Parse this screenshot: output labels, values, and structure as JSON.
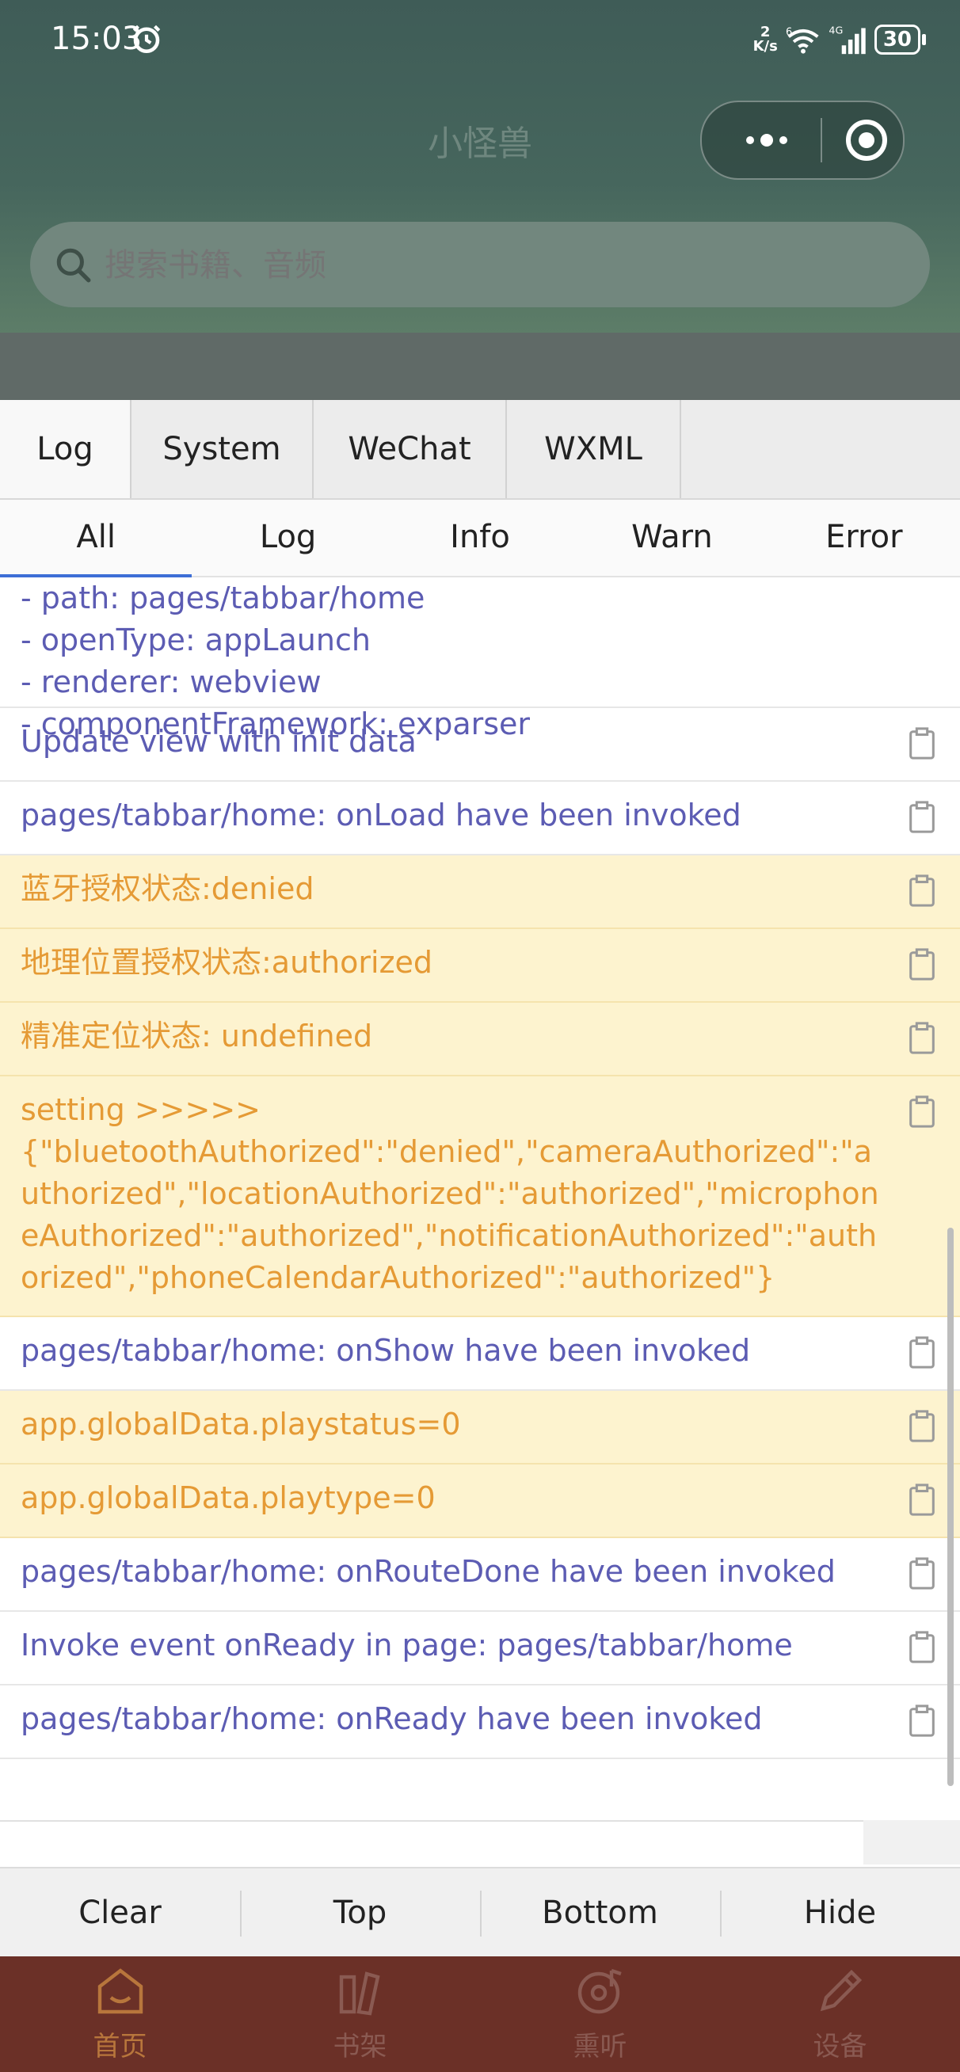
{
  "status_bar": {
    "time": "15:03",
    "net_speed_value": "2",
    "net_speed_unit": "K/s",
    "signal_label": "6",
    "network_label": "4G",
    "battery": "30"
  },
  "header": {
    "title": "小怪兽",
    "search_placeholder": "搜索书籍、音频"
  },
  "console": {
    "tabs": [
      {
        "label": "Log"
      },
      {
        "label": "System"
      },
      {
        "label": "WeChat"
      },
      {
        "label": "WXML"
      }
    ],
    "filters": [
      {
        "label": "All"
      },
      {
        "label": "Log"
      },
      {
        "label": "Info"
      },
      {
        "label": "Warn"
      },
      {
        "label": "Error"
      }
    ],
    "first_entry_lines": [
      "- path: pages/tabbar/home",
      "- openType: appLaunch",
      "- renderer: webview",
      "- componentFramework: exparser"
    ],
    "entries": [
      {
        "text": "Update view with init data",
        "level": "log"
      },
      {
        "text": "pages/tabbar/home: onLoad have been invoked",
        "level": "log"
      },
      {
        "text": "蓝牙授权状态:denied",
        "level": "warn"
      },
      {
        "text": "地理位置授权状态:authorized",
        "level": "warn"
      },
      {
        "text": "精准定位状态: undefined",
        "level": "warn"
      },
      {
        "text": "setting >>>>>",
        "text2": "{\"bluetoothAuthorized\":\"denied\",\"cameraAuthorized\":\"authorized\",\"locationAuthorized\":\"authorized\",\"microphoneAuthorized\":\"authorized\",\"notificationAuthorized\":\"authorized\",\"phoneCalendarAuthorized\":\"authorized\"}",
        "level": "warn"
      },
      {
        "text": "pages/tabbar/home: onShow have been invoked",
        "level": "log"
      },
      {
        "text": "app.globalData.playstatus=0",
        "level": "warn"
      },
      {
        "text": "app.globalData.playtype=0",
        "level": "warn"
      },
      {
        "text": "pages/tabbar/home: onRouteDone have been invoked",
        "level": "log"
      },
      {
        "text": "Invoke event onReady in page: pages/tabbar/home",
        "level": "log"
      },
      {
        "text": "pages/tabbar/home: onReady have been invoked",
        "level": "log"
      }
    ],
    "toolbar": {
      "clear": "Clear",
      "top": "Top",
      "bottom": "Bottom",
      "hide": "Hide"
    }
  },
  "tabbar": {
    "items": [
      {
        "label": "首页",
        "icon": "home-icon"
      },
      {
        "label": "书架",
        "icon": "bookshelf-icon"
      },
      {
        "label": "熏听",
        "icon": "listen-icon"
      },
      {
        "label": "设备",
        "icon": "device-icon"
      }
    ]
  },
  "colors": {
    "log_text": "#5c5cb3",
    "warn_text": "#e59a35",
    "warn_bg": "#fdf3cf",
    "tabbar_bg": "#6b3027",
    "active_tab_label": "#b8763c"
  }
}
